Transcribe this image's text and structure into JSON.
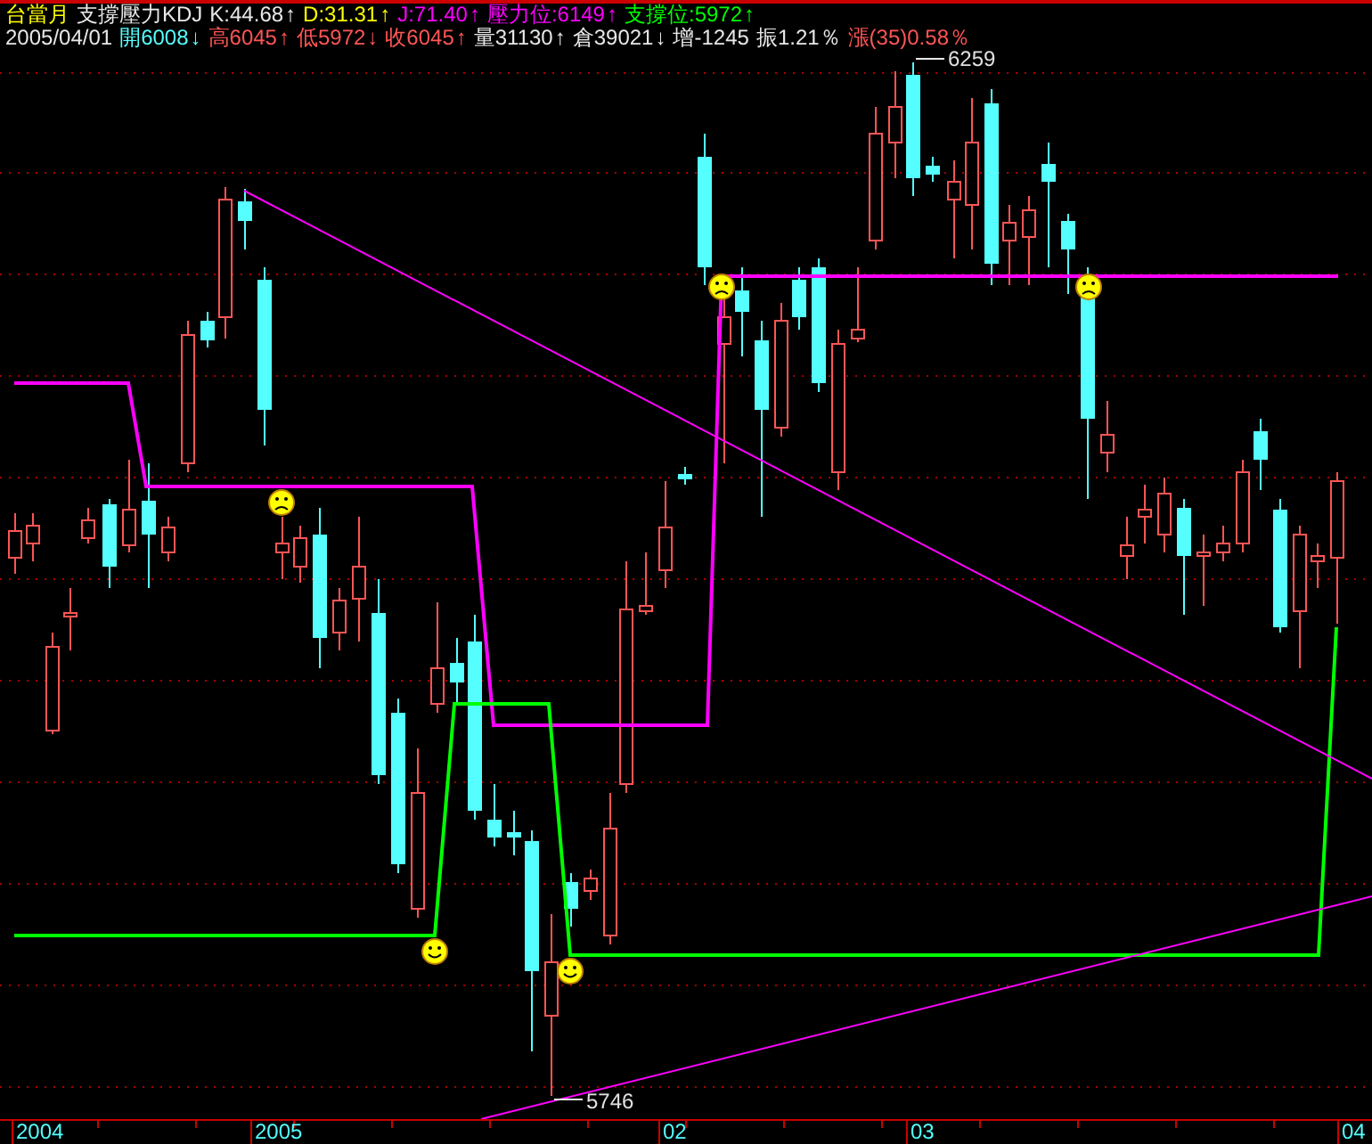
{
  "header": {
    "line_1": [
      {
        "text": "台當月",
        "color": "#ffff00"
      },
      {
        "text": "支撐壓力KDJ",
        "color": "#e8e8e8"
      },
      {
        "text": "K:44.68",
        "arrow": "↑",
        "color": "#e8e8e8"
      },
      {
        "text": "D:31.31",
        "arrow": "↑",
        "color": "#ffff00"
      },
      {
        "text": "J:71.40",
        "arrow": "↑",
        "color": "#ff00ff"
      },
      {
        "text": "壓力位:6149",
        "arrow": "↑",
        "color": "#ff00ff"
      },
      {
        "text": "支撐位:5972",
        "arrow": "↑",
        "color": "#00ff00"
      }
    ],
    "line_2": [
      {
        "text": "2005/04/01",
        "color": "#e8e8e8"
      },
      {
        "text": "開6008",
        "arrow": "↓",
        "color": "#55ffff"
      },
      {
        "text": "高6045",
        "arrow": "↑",
        "color": "#ff5555"
      },
      {
        "text": "低5972",
        "arrow": "↓",
        "color": "#ff5555"
      },
      {
        "text": "收6045",
        "arrow": "↑",
        "color": "#ff5555"
      },
      {
        "text": "量31130",
        "arrow": "↑",
        "color": "#e8e8e8"
      },
      {
        "text": "倉39021",
        "arrow": "↓",
        "color": "#e8e8e8"
      },
      {
        "text": "增-1245",
        "color": "#e8e8e8"
      },
      {
        "text": "振1.21％",
        "color": "#e8e8e8"
      },
      {
        "text": "漲(35)0.58％",
        "color": "#ff5555"
      }
    ]
  },
  "chart": {
    "high_label": "6259",
    "low_label": "5746",
    "x_labels": [
      "2004",
      "2005",
      "02",
      "03",
      "04"
    ]
  }
}
